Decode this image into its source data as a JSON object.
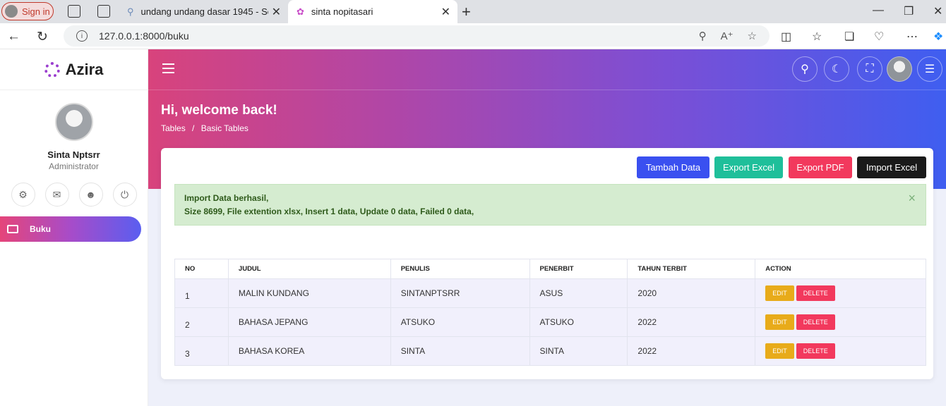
{
  "browser": {
    "signin_label": "Sign in",
    "tabs": [
      {
        "title": "undang undang dasar 1945 - Sea"
      },
      {
        "title": "sinta nopitasari"
      }
    ],
    "url": "127.0.0.1:8000/buku"
  },
  "sidebar": {
    "brand": "Azira",
    "user_name": "Sinta Nptsrr",
    "user_role": "Administrator",
    "menu": [
      {
        "label": "Buku"
      }
    ]
  },
  "header": {
    "welcome": "Hi, welcome back!",
    "breadcrumb": [
      "Tables",
      "/",
      "Basic Tables"
    ]
  },
  "actions": {
    "tambah": "Tambah Data",
    "export_excel": "Export Excel",
    "export_pdf": "Export PDF",
    "import_excel": "Import Excel"
  },
  "alert": {
    "line1": "Import Data berhasil,",
    "line2": "Size 8699, File extention xlsx, Insert 1 data, Update 0 data, Failed 0 data,",
    "close": "×"
  },
  "table": {
    "headers": [
      "NO",
      "JUDUL",
      "PENULIS",
      "PENERBIT",
      "TAHUN TERBIT",
      "ACTION"
    ],
    "rows": [
      {
        "no": "1",
        "judul": "MALIN KUNDANG",
        "penulis": "SINTANPTSRR",
        "penerbit": "ASUS",
        "tahun": "2020"
      },
      {
        "no": "2",
        "judul": "BAHASA JEPANG",
        "penulis": "ATSUKO",
        "penerbit": "ATSUKO",
        "tahun": "2022"
      },
      {
        "no": "3",
        "judul": "BAHASA KOREA",
        "penulis": "SINTA",
        "penerbit": "SINTA",
        "tahun": "2022"
      }
    ],
    "edit_label": "EDIT",
    "delete_label": "DELETE"
  },
  "colors": {
    "tambah": "#3a50f0",
    "export_excel": "#1fbf9a",
    "export_pdf": "#f2395d",
    "import_excel": "#1a1a1a"
  }
}
